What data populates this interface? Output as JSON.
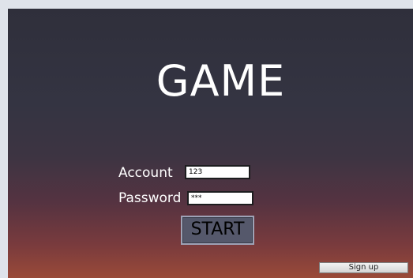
{
  "title": "GAME",
  "form": {
    "account_label": "Account",
    "account_value": "123",
    "password_label": "Password",
    "password_value": "***"
  },
  "buttons": {
    "start_label": "START",
    "signup_label": "Sign up"
  }
}
